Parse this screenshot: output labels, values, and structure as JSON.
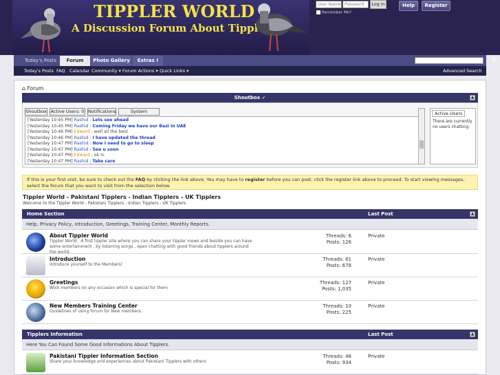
{
  "header": {
    "title": "TIPPLER WORLD",
    "subtitle": "A Discussion Forum About Tipplers",
    "login": {
      "username_placeholder": "User Name",
      "password_placeholder": "Password",
      "login_label": "Log in",
      "remember_label": "Remember Me?"
    },
    "help_label": "Help",
    "register_label": "Register"
  },
  "nav": {
    "tabs": [
      "Today's Posts",
      "Forum",
      "Photo Gallery",
      "Extras !"
    ],
    "sub": [
      "Today's Posts",
      "FAQ",
      "Calendar",
      "Community ▾",
      "Forum Actions ▾",
      "Quick Links ▾"
    ],
    "advanced_search": "Advanced Search"
  },
  "breadcrumb": "Forum",
  "shoutbox": {
    "title": "Shoutbox",
    "tabs": [
      "Shoutbox",
      "Active Users: 0",
      "Notifications",
      "System Messages"
    ],
    "messages": [
      {
        "time": "[Yesterday 10:45 PM]",
        "user": "Rashid",
        "text": "Lets see ahead",
        "bold": true,
        "alt": false
      },
      {
        "time": "[Yesterday 10:45 PM]",
        "user": "Rashid",
        "text": "Coming Friday we have our Bazi in UAE",
        "bold": true,
        "alt": false
      },
      {
        "time": "[Yesterday 10:46 PM]",
        "user": "Edward",
        "text": "well all the best",
        "bold": false,
        "alt": true
      },
      {
        "time": "[Yesterday 10:46 PM]",
        "user": "Rashid",
        "text": "I have updated the thread",
        "bold": true,
        "alt": false
      },
      {
        "time": "[Yesterday 10:47 PM]",
        "user": "Rashid",
        "text": "Now I need to go to sleep",
        "bold": true,
        "alt": false
      },
      {
        "time": "[Yesterday 10:47 PM]",
        "user": "Rashid",
        "text": "See u soon",
        "bold": true,
        "alt": false
      },
      {
        "time": "[Yesterday 10:47 PM]",
        "user": "Edward",
        "text": "ok tc",
        "bold": false,
        "alt": true
      },
      {
        "time": "[Yesterday 10:47 PM]",
        "user": "Rashid",
        "text": "Take care",
        "bold": true,
        "alt": false
      }
    ],
    "active_users_title": "Active Users",
    "active_users_text": "There are currently no users chatting."
  },
  "notice": {
    "part1": "If this is your first visit, be sure to check out the ",
    "faq": "FAQ",
    "part2": " by clicking the link above. You may have to ",
    "register": "register",
    "part3": " before you can post: click the register link above to proceed. To start viewing messages, select the forum that you want to visit from the selection below."
  },
  "forum": {
    "title": "Tippler World - Pakistani Tipplers - Indian Tipplers - UK Tipplers",
    "description": "Welcome to the Tippler World - Pakistani Tipplers - Indian Tipplers - UK Tipplers."
  },
  "categories": [
    {
      "name": "Home Section",
      "last_post_label": "Last Post",
      "description": "Help, Privacy Policy, Introduction, Greetings, Training Center, Monthly Reports.",
      "forums": [
        {
          "name": "About Tippler World",
          "desc": "Tippler World . A first tippler site where you can share your tippler views and beside you can have some entertainment , by listening songs , open chatting with good friends about tipplers around the world.",
          "threads": "Threads: 6",
          "posts": "Posts: 126",
          "last": "Private"
        },
        {
          "name": "Introduction",
          "desc": "Introduce yourself to the Members!",
          "threads": "Threads: 61",
          "posts": "Posts: 678",
          "last": "Private"
        },
        {
          "name": "Greetings",
          "desc": "Wish members on any occasion which is special for them",
          "threads": "Threads: 127",
          "posts": "Posts: 1,035",
          "last": "Private"
        },
        {
          "name": "New Members Training Center",
          "desc": "Guidelines of using forum for New members.",
          "threads": "Threads: 10",
          "posts": "Posts: 225",
          "last": "Private"
        }
      ]
    },
    {
      "name": "Tipplers Information",
      "last_post_label": "Last Post",
      "description": "Here You Can Found Some Good Informations About Tipplers.",
      "forums": [
        {
          "name": "Pakistani Tippler Information Section",
          "desc": "Share your knowledge and experiences about Pakistani Tipplers with others",
          "threads": "Threads: 48",
          "posts": "Posts: 934",
          "last": "Private"
        }
      ]
    }
  ]
}
